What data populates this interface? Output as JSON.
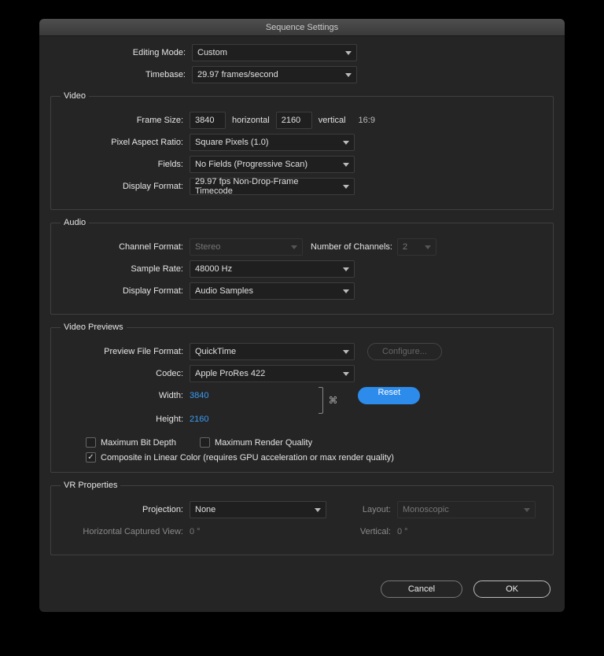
{
  "window": {
    "title": "Sequence Settings"
  },
  "top": {
    "editing_mode_label": "Editing Mode:",
    "editing_mode_value": "Custom",
    "timebase_label": "Timebase:",
    "timebase_value": "29.97  frames/second"
  },
  "video": {
    "legend": "Video",
    "frame_size_label": "Frame Size:",
    "frame_w": "3840",
    "horizontal": "horizontal",
    "frame_h": "2160",
    "vertical": "vertical",
    "aspect": "16:9",
    "par_label": "Pixel Aspect Ratio:",
    "par_value": "Square Pixels (1.0)",
    "fields_label": "Fields:",
    "fields_value": "No Fields (Progressive Scan)",
    "display_format_label": "Display Format:",
    "display_format_value": "29.97 fps Non-Drop-Frame Timecode"
  },
  "audio": {
    "legend": "Audio",
    "channel_format_label": "Channel Format:",
    "channel_format_value": "Stereo",
    "num_channels_label": "Number of Channels:",
    "num_channels_value": "2",
    "sample_rate_label": "Sample Rate:",
    "sample_rate_value": "48000 Hz",
    "display_format_label": "Display Format:",
    "display_format_value": "Audio Samples"
  },
  "previews": {
    "legend": "Video Previews",
    "pff_label": "Preview File Format:",
    "pff_value": "QuickTime",
    "configure_btn": "Configure...",
    "codec_label": "Codec:",
    "codec_value": "Apple ProRes 422",
    "width_label": "Width:",
    "width_value": "3840",
    "height_label": "Height:",
    "height_value": "2160",
    "reset_btn": "Reset",
    "max_bit_depth": "Maximum Bit Depth",
    "max_render_quality": "Maximum Render Quality",
    "composite_linear": "Composite in Linear Color (requires GPU acceleration or max render quality)"
  },
  "vr": {
    "legend": "VR Properties",
    "projection_label": "Projection:",
    "projection_value": "None",
    "layout_label": "Layout:",
    "layout_value": "Monoscopic",
    "hcv_label": "Horizontal Captured View:",
    "hcv_value": "0 °",
    "vertical_label": "Vertical:",
    "vertical_value": "0 °"
  },
  "footer": {
    "cancel": "Cancel",
    "ok": "OK"
  }
}
